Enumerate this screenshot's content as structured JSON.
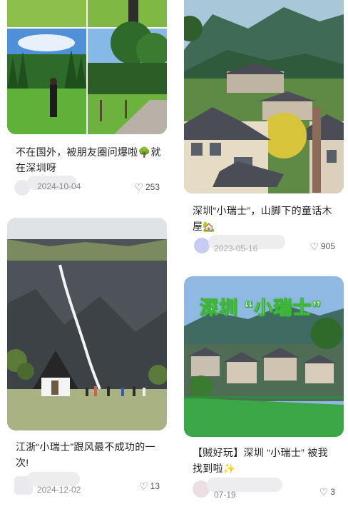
{
  "feed": {
    "posts": [
      {
        "title_line1": "不在国外，被朋友圈问爆啦🌳就",
        "title_line2": "在深圳呀",
        "date": "2024-10-04",
        "likes": "253",
        "like_icon": "heart-outline-icon"
      },
      {
        "title_line1": "深圳“小瑞士”，山脚下的童话木",
        "title_line2": "屋🏡",
        "date": "2023-05-16",
        "likes": "905",
        "like_icon": "heart-outline-icon"
      },
      {
        "title_line1": "江浙“小瑞士”跟风最不成功的一",
        "title_line2": "次!",
        "date": "2024-12-02",
        "likes": "13",
        "like_icon": "heart-outline-icon"
      },
      {
        "title_line1": "【贼好玩】深圳 “小瑞士” 被我",
        "title_line2": "找到啦✨",
        "date": "07-19",
        "likes": "3",
        "like_icon": "heart-outline-icon",
        "image_caption": "深圳 “小瑞士”"
      }
    ]
  },
  "colors": {
    "accent_green": "#3fb53a",
    "caption_text": "#ffffff",
    "meta_gray": "#8a8a8a"
  }
}
